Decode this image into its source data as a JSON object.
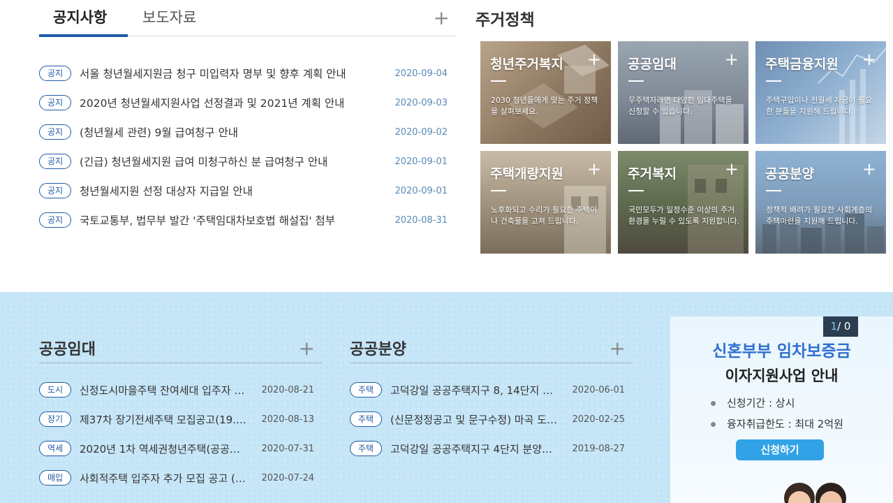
{
  "notice": {
    "tabs": [
      "공지사항",
      "보도자료"
    ],
    "items": [
      {
        "badge": "공지",
        "title": "서울 청년월세지원금 청구 미입력자 명부 및 향후 계획 안내",
        "date": "2020-09-04"
      },
      {
        "badge": "공지",
        "title": "2020년 청년월세지원사업 선정결과 및 2021년 계획 안내",
        "date": "2020-09-03"
      },
      {
        "badge": "공지",
        "title": "(청년월세 관련) 9월 급여청구 안내",
        "date": "2020-09-02"
      },
      {
        "badge": "공지",
        "title": "(긴급) 청년월세지원 급여 미청구하신 분 급여청구 안내",
        "date": "2020-09-01"
      },
      {
        "badge": "공지",
        "title": "청년월세지원 선정 대상자 지급일 안내",
        "date": "2020-09-01"
      },
      {
        "badge": "공지",
        "title": "국토교통부, 법무부 발간 '주택임대차보호법 해설집' 첨부",
        "date": "2020-08-31"
      }
    ]
  },
  "policy": {
    "title": "주거정책",
    "cards": [
      {
        "title": "청년주거복지",
        "desc": "2030 청년들에게 맞는 주거 정책을 살펴보세요."
      },
      {
        "title": "공공임대",
        "desc": "무주택자라면 다양한 임대주택을 신청할 수 있습니다."
      },
      {
        "title": "주택금융지원",
        "desc": "주택구입이나 전월세 자금이 필요한 분들을 지원해 드립니다."
      },
      {
        "title": "주택개량지원",
        "desc": "노후화되고 수리가 필요한 주택이나 건축물을 고쳐 드립니다."
      },
      {
        "title": "주거복지",
        "desc": "국민모두가 일정수준 이상의 주거 환경을 누릴 수 있도록 지원합니다."
      },
      {
        "title": "공공분양",
        "desc": "정책적 배려가 필요한 사회계층의 주택마련을 지원해 드립니다."
      }
    ]
  },
  "rental": {
    "title": "공공임대",
    "items": [
      {
        "badge": "도시",
        "title": "신정도시마을주택 잔여세대 입주자 …",
        "date": "2020-08-21"
      },
      {
        "badge": "장기",
        "title": "제37차 장기전세주택 모집공고(19.…",
        "date": "2020-08-13"
      },
      {
        "badge": "역세",
        "title": "2020년 1차 역세권청년주택(공공…",
        "date": "2020-07-31"
      },
      {
        "badge": "매입",
        "title": "사회적주택 입주자 추가 모집 공고 (…",
        "date": "2020-07-24"
      }
    ]
  },
  "sale": {
    "title": "공공분양",
    "items": [
      {
        "badge": "주택",
        "title": "고덕강일 공공주택지구 8, 14단지 …",
        "date": "2020-06-01"
      },
      {
        "badge": "주택",
        "title": "(신문정정공고 및 문구수정) 마곡 도…",
        "date": "2020-02-25"
      },
      {
        "badge": "주택",
        "title": "고덕강일 공공주택지구 4단지 분양…",
        "date": "2019-08-27"
      }
    ]
  },
  "banner": {
    "pager_current": "1",
    "pager_sep": "/",
    "pager_total": "0",
    "headline": "신혼부부 임차보증금",
    "subline": "이자지원사업 안내",
    "info": [
      "신청기간 : 상시",
      "융자취급한도 : 최대 2억원"
    ],
    "button": "신청하기"
  },
  "icons": {
    "more": "plus-icon",
    "bullet": "dot-icon"
  },
  "colors": {
    "accent": "#1f5aa6",
    "band": "#c7e6f7",
    "button": "#31a2e5",
    "banner_headline": "#2f6fd0"
  }
}
